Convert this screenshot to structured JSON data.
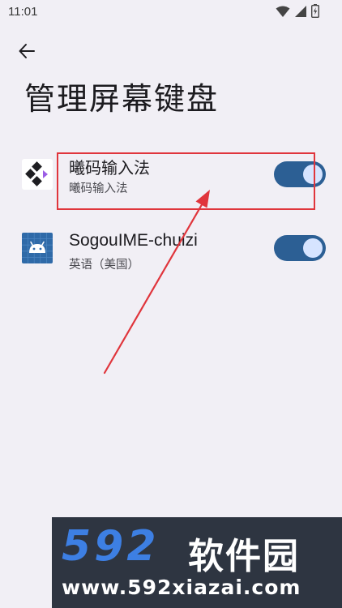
{
  "status_bar": {
    "time": "11:01",
    "icons": [
      "wifi-icon",
      "signal-icon",
      "battery-icon"
    ]
  },
  "header": {
    "back_icon": "arrow-back-icon",
    "title": "管理屏幕键盘"
  },
  "keyboards": [
    {
      "name": "曦码输入法",
      "subtitle": "曦码输入法",
      "enabled": true,
      "icon": "ximа-ime-logo-icon"
    },
    {
      "name": "SogouIME-chuizi",
      "subtitle": "英语（美国）",
      "enabled": true,
      "icon": "android-robot-icon"
    }
  ],
  "colors": {
    "background": "#f1eff5",
    "toggle_track": "#2c5f94",
    "toggle_thumb": "#d6e4ff",
    "annotation": "#e0353c"
  },
  "watermark": {
    "logo_number": "592",
    "logo_text": "软件园",
    "url": "www.592xiazai.com"
  }
}
